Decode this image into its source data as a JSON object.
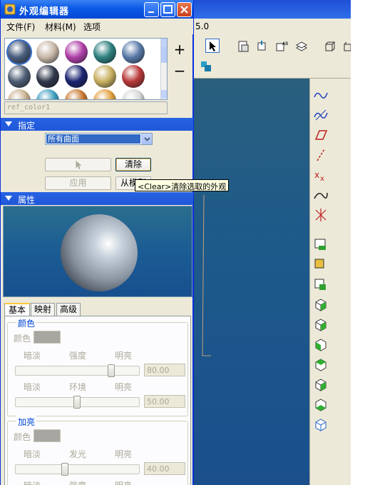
{
  "background_app": {
    "version_text": "5.0"
  },
  "dialog": {
    "title": "外观编辑器",
    "menu": [
      {
        "label": "文件(F)"
      },
      {
        "label": "材料(M)"
      },
      {
        "label": "选项"
      }
    ],
    "swatches": [
      {
        "color": "#4a5e7e"
      },
      {
        "color": "#c8b8a8"
      },
      {
        "color": "#b040a8"
      },
      {
        "color": "#2f8080"
      },
      {
        "color": "#5a7aa8"
      },
      {
        "color": "#4e5e74"
      },
      {
        "color": "#30384a"
      },
      {
        "color": "#1a2470"
      },
      {
        "color": "#c8b060"
      },
      {
        "color": "#b83838"
      },
      {
        "color": "#c8b090"
      },
      {
        "color": "#40a0c0"
      },
      {
        "color": "#c87830"
      },
      {
        "color": "#e0a040"
      },
      {
        "color": "#d8d8d8"
      }
    ],
    "add_label": "+",
    "remove_label": "−",
    "ref_color": "ref_color1",
    "assign_section": {
      "title": "指定",
      "surface_select": "所有曲面",
      "clear_button": "清除",
      "apply_button": "应用",
      "from_model_button": "从模型"
    },
    "tooltip": "<Clear>清除选取的外观",
    "properties_section": {
      "title": "属性"
    },
    "tabs": [
      {
        "label": "基本"
      },
      {
        "label": "映射"
      },
      {
        "label": "高级"
      }
    ],
    "color_group": {
      "title": "颜色",
      "color_label": "颜色",
      "intensity": {
        "left": "暗淡",
        "center": "强度",
        "right": "明亮",
        "value": "80.00",
        "level": 80
      },
      "ambient": {
        "left": "暗淡",
        "center": "环境",
        "right": "明亮",
        "value": "50.00",
        "level": 50
      }
    },
    "highlight_group": {
      "title": "加亮",
      "color_label": "颜色",
      "shine": {
        "left": "暗淡",
        "center": "发光",
        "right": "明亮",
        "value": "40.00",
        "level": 40
      },
      "strength": {
        "left": "暗淡",
        "center": "强度",
        "right": "明亮"
      }
    }
  }
}
